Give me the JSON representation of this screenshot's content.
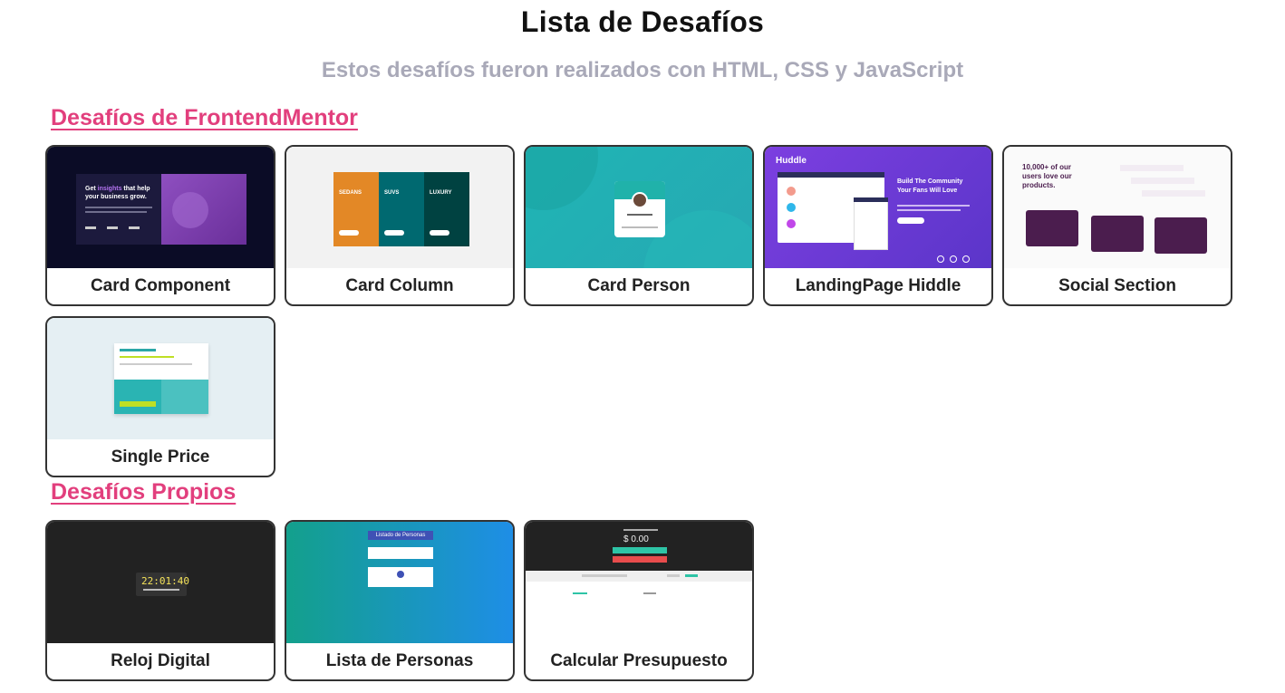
{
  "header": {
    "title": "Lista de Desafíos",
    "subtitle": "Estos desafíos fueron realizados con HTML, CSS y JavaScript"
  },
  "sections": [
    {
      "title": "Desafíos de FrontendMentor",
      "cards": [
        {
          "label": "Card Component"
        },
        {
          "label": "Card Column"
        },
        {
          "label": "Card Person"
        },
        {
          "label": "LandingPage Hiddle"
        },
        {
          "label": "Social Section"
        },
        {
          "label": "Single Price"
        }
      ]
    },
    {
      "title": "Desafíos Propios",
      "cards": [
        {
          "label": "Reloj Digital"
        },
        {
          "label": "Lista de Personas"
        },
        {
          "label": "Calcular Presupuesto"
        }
      ]
    }
  ],
  "thumbnails": {
    "card_component": {
      "headline_a": "Get ",
      "headline_accent": "insights",
      "headline_b": " that help",
      "headline_c": "your business grow."
    },
    "card_column": {
      "col1": "SEDANS",
      "col2": "SUVS",
      "col3": "LUXURY"
    },
    "landing_huddle": {
      "logo": "Huddle",
      "headline_a": "Build The Community",
      "headline_b": "Your Fans Will Love"
    },
    "social_section": {
      "headline_a": "10,000+ of our",
      "headline_b": "users love our",
      "headline_c": "products."
    },
    "reloj": {
      "time": "22:01:40"
    },
    "lista_personas": {
      "header": "Listado de Personas"
    },
    "presupuesto": {
      "amount": "$ 0.00"
    }
  },
  "colors": {
    "accent": "#e23f7d",
    "subtitle": "#a9a9b8",
    "card_border": "#333333"
  }
}
